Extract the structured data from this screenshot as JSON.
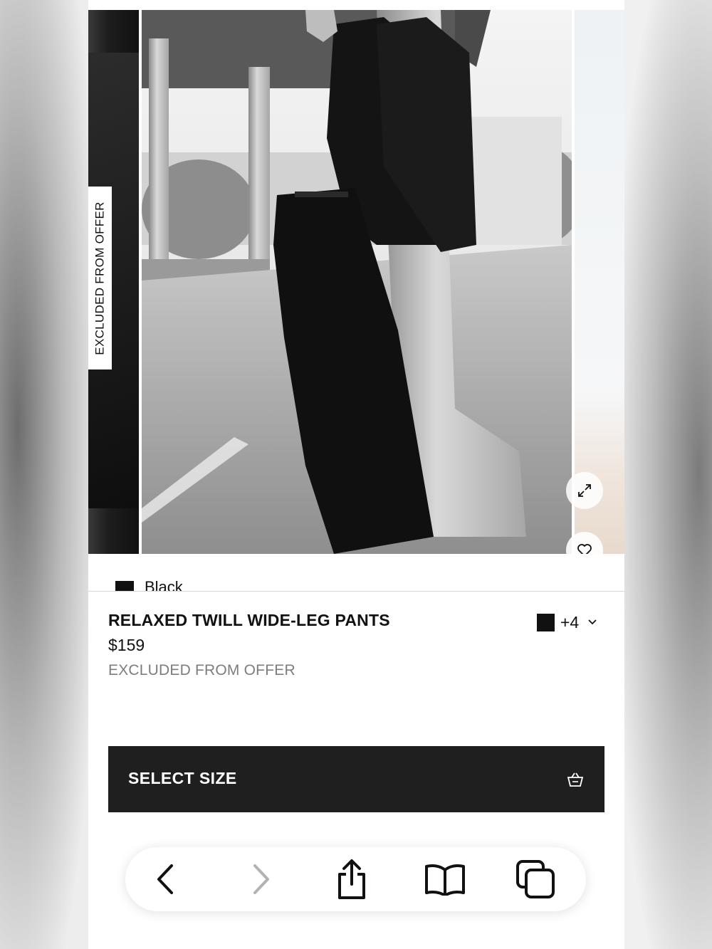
{
  "gallery": {
    "badge_text": "EXCLUDED FROM OFFER",
    "expand_icon": "expand-icon",
    "favorite_icon": "heart-icon"
  },
  "color_peek": {
    "name": "Black"
  },
  "product": {
    "title": "RELAXED TWILL WIDE-LEG PANTS",
    "price": "$159",
    "offer_note": "EXCLUDED FROM OFFER",
    "selected_color_hex": "#111111",
    "more_colors": "+4"
  },
  "actions": {
    "select_size_label": "SELECT SIZE",
    "bag_icon": "shopping-bag-icon"
  },
  "browser_toolbar": {
    "items": [
      "back-icon",
      "forward-icon",
      "share-icon",
      "bookmarks-icon",
      "tabs-icon"
    ],
    "forward_enabled": false
  }
}
